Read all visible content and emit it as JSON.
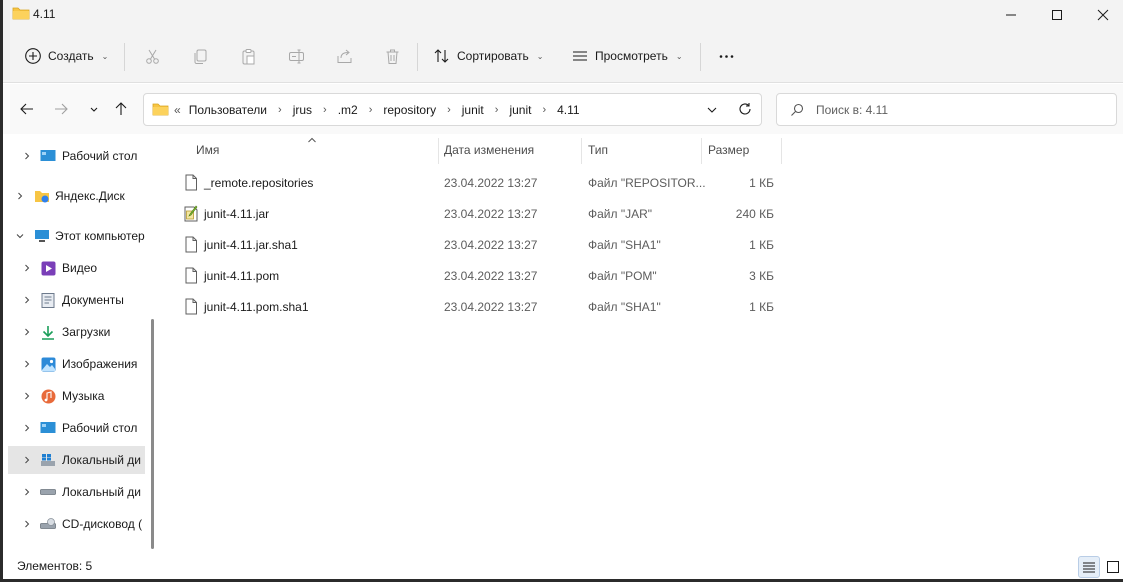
{
  "window": {
    "title": "4.11",
    "accent": "#0067c0",
    "folder_color": "#f7c544"
  },
  "commandbar": {
    "create_label": "Создать",
    "sort_label": "Сортировать",
    "view_label": "Просмотреть"
  },
  "address": {
    "overflow": "«",
    "crumbs": [
      "Пользователи",
      "jrus",
      ".m2",
      "repository",
      "junit",
      "junit",
      "4.11"
    ]
  },
  "search": {
    "placeholder": "Поиск в: 4.11"
  },
  "sidebar": {
    "items": [
      {
        "label": "Рабочий стол",
        "icon": "desktop-icon",
        "expanded": false
      },
      {
        "label": "Яндекс.Диск",
        "icon": "yandex-disk-icon",
        "expanded": false
      },
      {
        "label": "Этот компьютер",
        "icon": "this-pc-icon",
        "expanded": true
      },
      {
        "label": "Видео",
        "icon": "video-icon",
        "expanded": false
      },
      {
        "label": "Документы",
        "icon": "documents-icon",
        "expanded": false
      },
      {
        "label": "Загрузки",
        "icon": "downloads-icon",
        "expanded": false
      },
      {
        "label": "Изображения",
        "icon": "pictures-icon",
        "expanded": false
      },
      {
        "label": "Музыка",
        "icon": "music-icon",
        "expanded": false
      },
      {
        "label": "Рабочий стол",
        "icon": "desktop-icon",
        "expanded": false
      },
      {
        "label": "Локальный ди",
        "icon": "windows-drive-icon",
        "expanded": false,
        "selected": true
      },
      {
        "label": "Локальный ди",
        "icon": "drive-icon",
        "expanded": false
      },
      {
        "label": "CD-дисковод (",
        "icon": "cd-drive-icon",
        "expanded": false
      }
    ]
  },
  "columns": {
    "name": "Имя",
    "date": "Дата изменения",
    "type": "Тип",
    "size": "Размер"
  },
  "files": [
    {
      "name": "_remote.repositories",
      "date": "23.04.2022 13:27",
      "type": "Файл \"REPOSITOR...",
      "size": "1 КБ",
      "icon": "file-icon"
    },
    {
      "name": "junit-4.11.jar",
      "date": "23.04.2022 13:27",
      "type": "Файл \"JAR\"",
      "size": "240 КБ",
      "icon": "jar-file-icon"
    },
    {
      "name": "junit-4.11.jar.sha1",
      "date": "23.04.2022 13:27",
      "type": "Файл \"SHA1\"",
      "size": "1 КБ",
      "icon": "file-icon"
    },
    {
      "name": "junit-4.11.pom",
      "date": "23.04.2022 13:27",
      "type": "Файл \"POM\"",
      "size": "3 КБ",
      "icon": "file-icon"
    },
    {
      "name": "junit-4.11.pom.sha1",
      "date": "23.04.2022 13:27",
      "type": "Файл \"SHA1\"",
      "size": "1 КБ",
      "icon": "file-icon"
    }
  ],
  "status": {
    "items_count": "Элементов: 5"
  }
}
